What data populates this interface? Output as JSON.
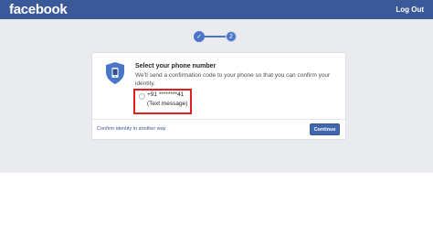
{
  "header": {
    "logo_text": "facebook",
    "logout_label": "Log Out"
  },
  "stepper": {
    "completed_icon": "check-icon",
    "current_step": "2"
  },
  "card": {
    "title": "Select your phone number",
    "description": "We'll send a confirmation code to your phone so that you can confirm your identity.",
    "phone_option": {
      "number": "+91 ********41",
      "method": "(Text message)"
    },
    "alternate_link": "Confirm identity in another way",
    "continue_label": "Continue"
  },
  "colors": {
    "brand": "#3b5998",
    "button": "#4267b2",
    "highlight": "#e02020",
    "background": "#e9ebee"
  }
}
